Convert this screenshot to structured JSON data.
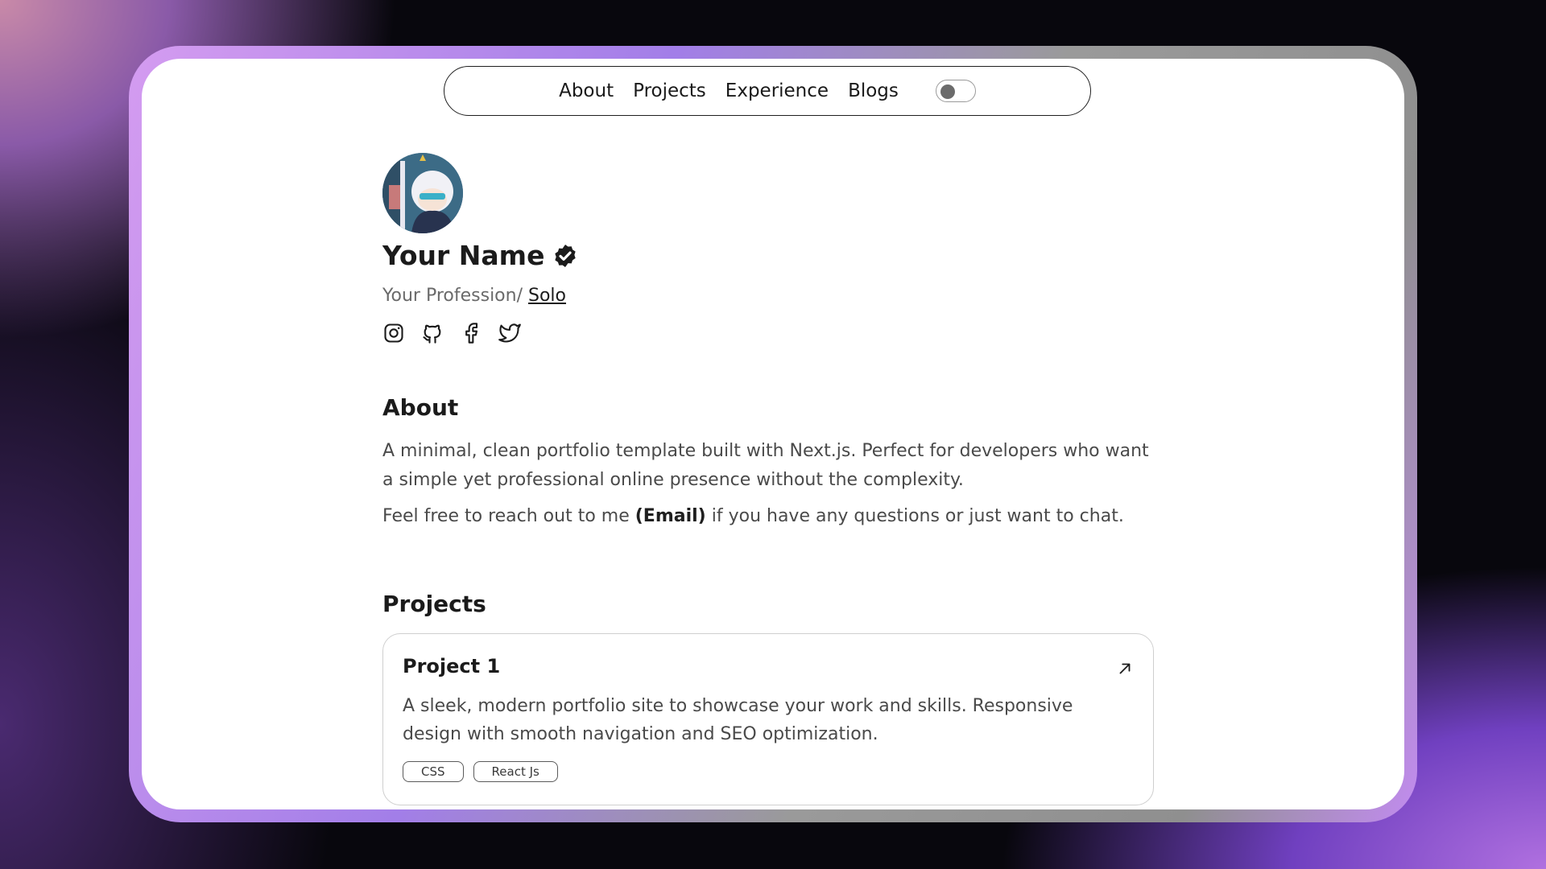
{
  "nav": {
    "links": [
      "About",
      "Projects",
      "Experience",
      "Blogs"
    ],
    "theme_toggle": "off"
  },
  "profile": {
    "name": "Your Name",
    "profession": "Your Profession/ ",
    "profession_link": "Solo",
    "socials": [
      "instagram-icon",
      "github-icon",
      "facebook-icon",
      "twitter-icon"
    ]
  },
  "about": {
    "title": "About",
    "paragraph1": "A minimal, clean portfolio template built with Next.js. Perfect for developers who want a simple yet professional online presence without the complexity.",
    "paragraph2_pre": "Feel free to reach out to me ",
    "paragraph2_bold": "(Email)",
    "paragraph2_post": " if you have any questions or just want to chat."
  },
  "projects": {
    "title": "Projects",
    "items": [
      {
        "title": "Project 1",
        "description": "A sleek, modern portfolio site to showcase your work and skills. Responsive design with smooth navigation and SEO optimization.",
        "tags": [
          "CSS",
          "React Js"
        ]
      }
    ]
  },
  "colors": {
    "accent": "#b070e0",
    "text": "#1b1b1b",
    "muted": "#4a4a4a"
  }
}
